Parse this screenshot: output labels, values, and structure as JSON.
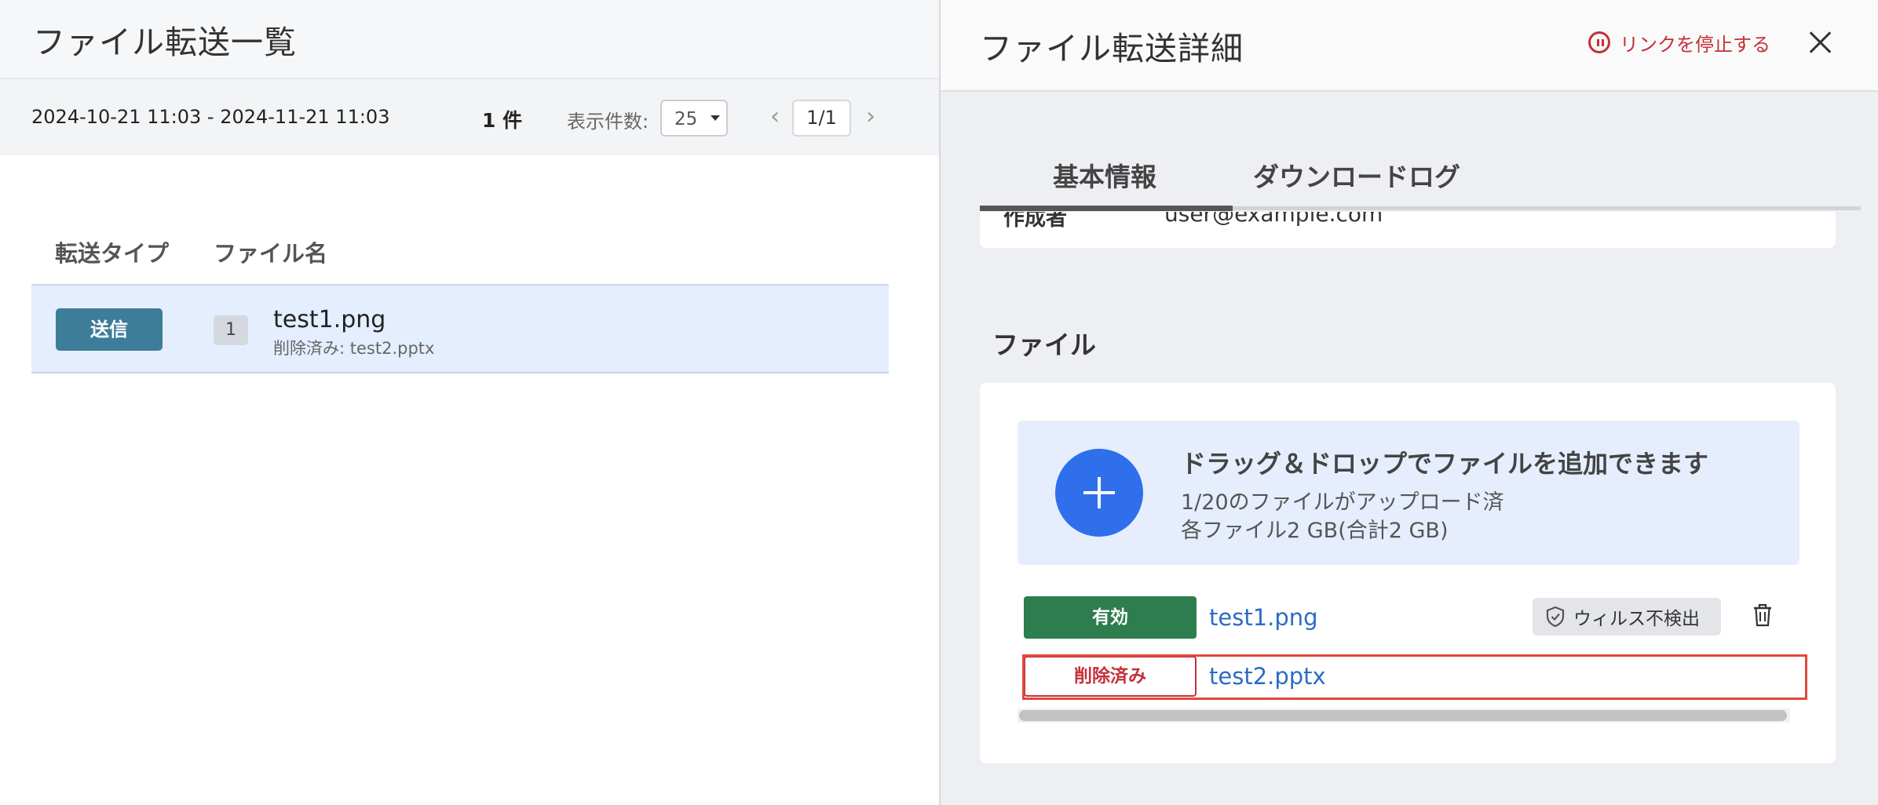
{
  "left": {
    "title": "ファイル転送一覧",
    "date_range": "2024-10-21 11:03 - 2024-11-21 11:03",
    "count": "1 件",
    "per_page_label": "表示件数:",
    "per_page_value": "25",
    "pagination": {
      "prev": "‹",
      "current": "1/1",
      "next": "›"
    },
    "columns": [
      "転送タイプ",
      "ファイル名"
    ],
    "rows": [
      {
        "type": "送信",
        "file_count": "1",
        "file_name": "test1.png",
        "sub_text": "削除済み: test2.pptx"
      }
    ]
  },
  "right": {
    "title": "ファイル転送詳細",
    "stop_link": "リンクを停止する",
    "tabs": [
      "基本情報",
      "ダウンロードログ"
    ],
    "active_tab": 0,
    "creator_label": "作成者",
    "creator_value": "user@example.com",
    "files_section_title": "ファイル",
    "dropzone": {
      "title": "ドラッグ＆ドロップでファイルを追加できます",
      "line1": "1/20のファイルがアップロード済",
      "line2": "各ファイル2 GB(合計2 GB)"
    },
    "files": [
      {
        "status": "有効",
        "name": "test1.png",
        "virus": "ウィルス不検出"
      },
      {
        "status": "削除済み",
        "name": "test2.pptx"
      }
    ]
  },
  "colors": {
    "accent_blue": "#2f6fec",
    "send_badge": "#3d7d99",
    "valid_green": "#2e7d4f",
    "danger_red": "#c4313a",
    "link_blue": "#2b6cc4",
    "highlight": "#e0483d"
  },
  "icons": {
    "stop": "pause-circle-icon",
    "close": "close-icon",
    "add": "plus-icon",
    "virus": "shield-check-icon",
    "delete": "trash-icon"
  }
}
